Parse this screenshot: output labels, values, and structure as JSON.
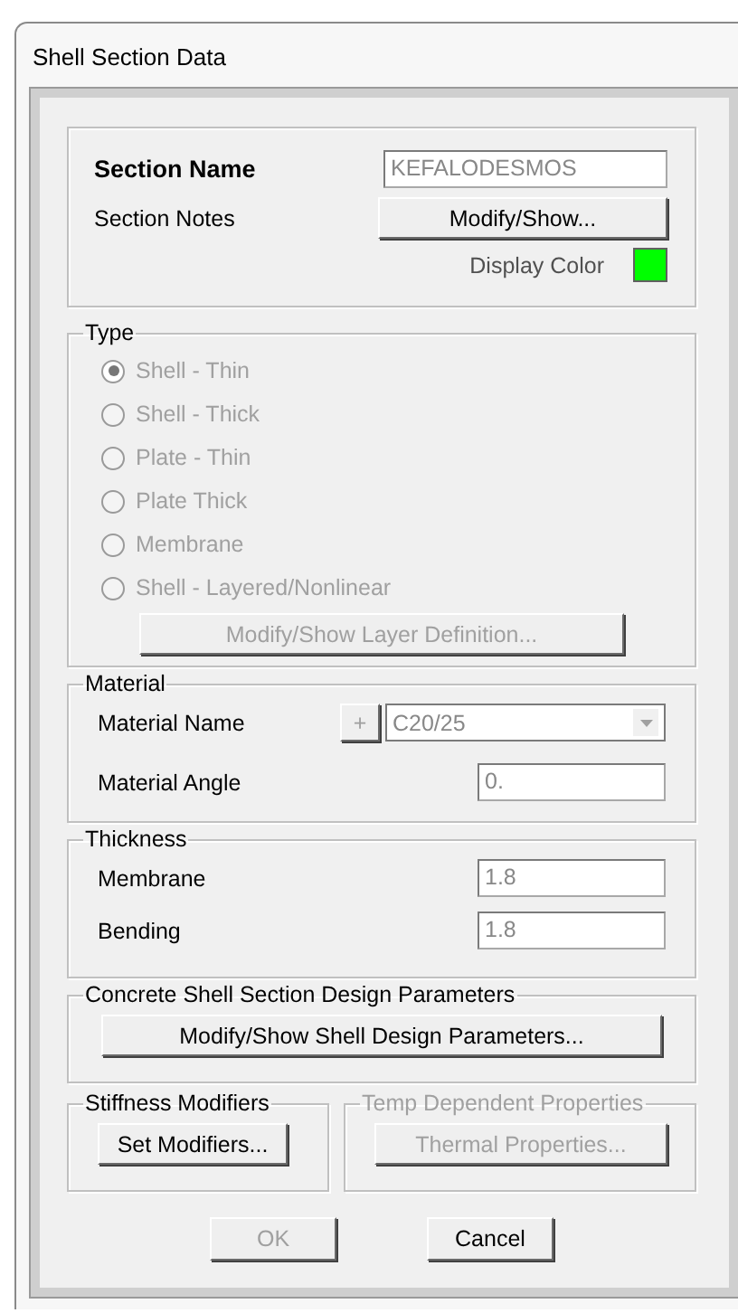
{
  "window": {
    "title": "Shell Section Data"
  },
  "section": {
    "name_label": "Section Name",
    "name_value": "KEFALODESMOS",
    "name_disabled": true,
    "notes_label": "Section Notes",
    "notes_button": "Modify/Show...",
    "color_label": "Display Color",
    "color": "#00ff00"
  },
  "type": {
    "title": "Type",
    "disabled": true,
    "options": [
      {
        "label": "Shell - Thin",
        "selected": true
      },
      {
        "label": "Shell - Thick",
        "selected": false
      },
      {
        "label": "Plate - Thin",
        "selected": false
      },
      {
        "label": "Plate Thick",
        "selected": false
      },
      {
        "label": "Membrane",
        "selected": false
      },
      {
        "label": "Shell - Layered/Nonlinear",
        "selected": false
      }
    ],
    "button": {
      "label": "Modify/Show Layer Definition...",
      "disabled": true
    }
  },
  "material": {
    "title": "Material",
    "name_label": "Material Name",
    "add_button": "+",
    "name_value": "C20/25",
    "angle_label": "Material Angle",
    "angle_value": "0.",
    "disabled": true
  },
  "thickness": {
    "title": "Thickness",
    "fields": [
      {
        "label": "Membrane",
        "value": "1.8",
        "disabled": true
      },
      {
        "label": "Bending",
        "value": "1.8",
        "disabled": true
      }
    ]
  },
  "design": {
    "title": "Concrete Shell Section Design Parameters",
    "button": "Modify/Show Shell Design Parameters..."
  },
  "stiffness": {
    "title": "Stiffness Modifiers",
    "disabled": false,
    "button": {
      "label": "Set Modifiers...",
      "disabled": false
    }
  },
  "temp": {
    "title": "Temp Dependent Properties",
    "disabled": true,
    "button": {
      "label": "Thermal Properties...",
      "disabled": true
    }
  },
  "buttons": [
    {
      "label": "OK",
      "disabled": true
    },
    {
      "label": "Cancel",
      "disabled": false
    }
  ]
}
